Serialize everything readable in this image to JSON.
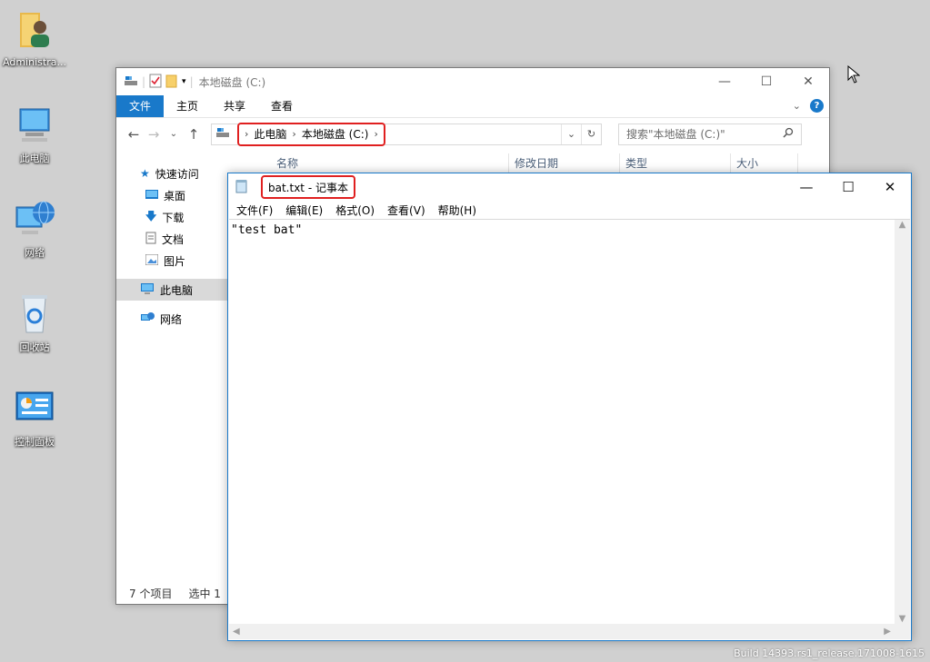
{
  "desktop": {
    "icons": [
      {
        "label": "Administra..."
      },
      {
        "label": "此电脑"
      },
      {
        "label": "网络"
      },
      {
        "label": "回收站"
      },
      {
        "label": "控制面板"
      }
    ],
    "build_text": "Build 14393.rs1_release.171008-1615"
  },
  "explorer": {
    "title": "本地磁盘 (C:)",
    "ribbon_tabs": [
      "文件",
      "主页",
      "共享",
      "查看"
    ],
    "breadcrumb": [
      "此电脑",
      "本地磁盘 (C:)"
    ],
    "search_placeholder": "搜索\"本地磁盘 (C:)\"",
    "columns": [
      "名称",
      "修改日期",
      "类型",
      "大小"
    ],
    "nav": {
      "quick_access": "快速访问",
      "desktop": "桌面",
      "downloads": "下载",
      "documents": "文档",
      "pictures": "图片",
      "this_pc": "此电脑",
      "network": "网络"
    },
    "status": {
      "item_count": "7 个项目",
      "selected": "选中 1"
    }
  },
  "notepad": {
    "title": "bat.txt - 记事本",
    "menu": [
      "文件(F)",
      "编辑(E)",
      "格式(O)",
      "查看(V)",
      "帮助(H)"
    ],
    "content": "\"test bat\""
  },
  "colors": {
    "accent": "#1979ca",
    "highlight_red": "#e02020",
    "desktop_bg": "#d0d0d0"
  }
}
